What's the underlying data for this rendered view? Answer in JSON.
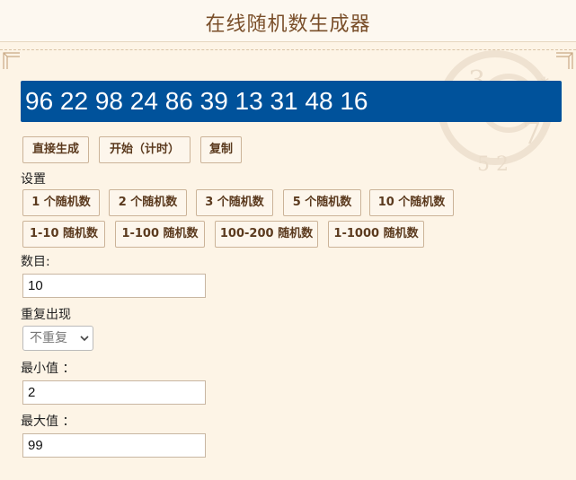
{
  "header": {
    "title": "在线随机数生成器"
  },
  "result": {
    "value": "96 22 98 24 86 39 13 31 48 16"
  },
  "actions": {
    "generate": "直接生成",
    "start_timer": "开始（计时）",
    "copy": "复制"
  },
  "settings": {
    "label": "设置",
    "presets_row1": [
      "1 个随机数",
      "2 个随机数",
      "3 个随机数",
      "5 个随机数",
      "10 个随机数"
    ],
    "presets_row2": [
      "1-10 随机数",
      "1-100 随机数",
      "100-200 随机数",
      "1-1000 随机数"
    ]
  },
  "form": {
    "count_label": "数目:",
    "count_value": "10",
    "repeat_label": "重复出现",
    "repeat_value": "不重复",
    "min_label": "最小值 ：",
    "min_value": "2",
    "max_label": "最大值 ：",
    "max_value": "99"
  },
  "colors": {
    "result_bg": "#00529b",
    "page_bg": "#fdf4e6",
    "title_color": "#7a4f2a",
    "button_text": "#5b3a1e"
  }
}
